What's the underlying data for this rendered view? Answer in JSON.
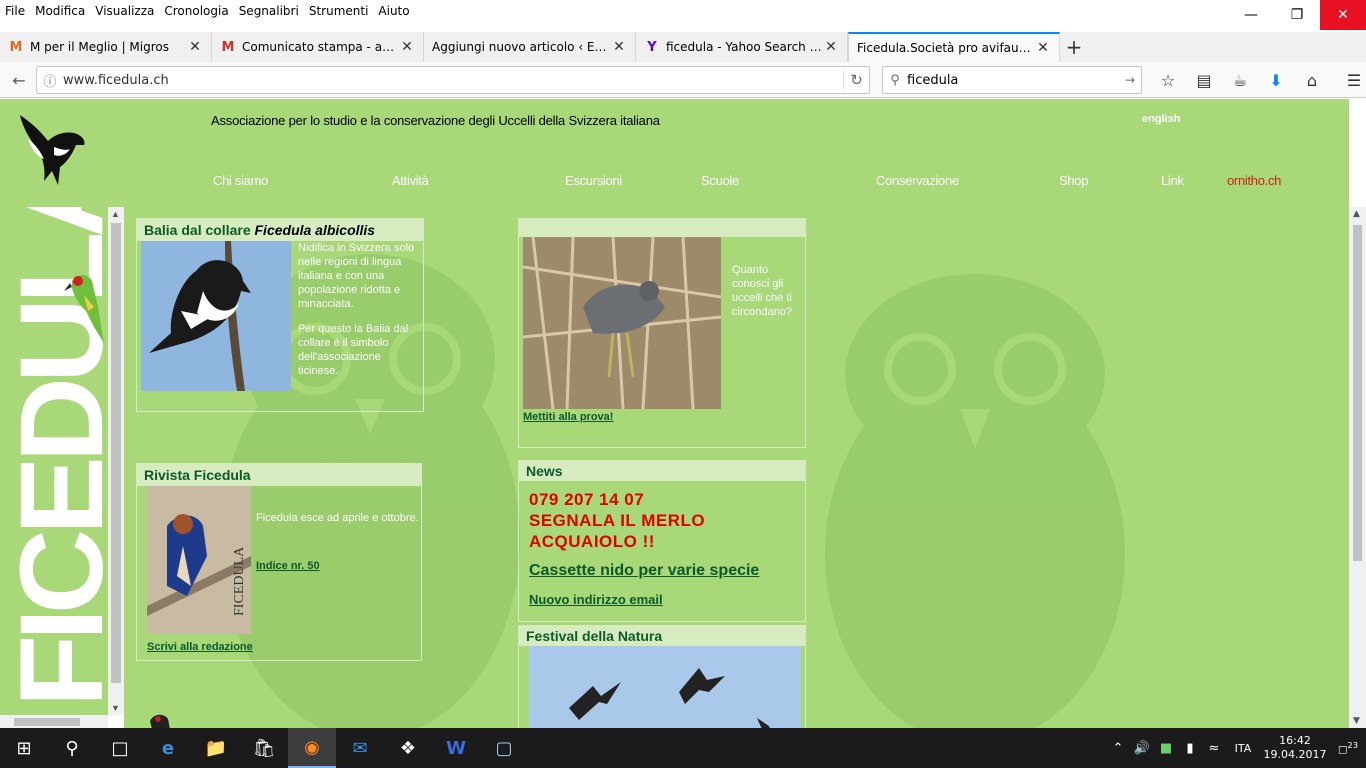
{
  "menubar": [
    "File",
    "Modifica",
    "Visualizza",
    "Cronologia",
    "Segnalibri",
    "Strumenti",
    "Aiuto"
  ],
  "tabs": [
    {
      "favicon": "M",
      "favicon_color": "#e8681c",
      "title": "M per il Meglio | Migros"
    },
    {
      "favicon": "M",
      "favicon_color": "#d93025",
      "title": "Comunicato stampa - ass..."
    },
    {
      "favicon": "",
      "favicon_color": "#666",
      "title": "Aggiungi nuovo articolo ‹ ETi..."
    },
    {
      "favicon": "Y",
      "favicon_color": "#5f01d1",
      "title": "ficedula - Yahoo Search R..."
    },
    {
      "favicon": "",
      "favicon_color": "#666",
      "title": "Ficedula.Società pro avifauna ..."
    }
  ],
  "url": "www.ficedula.ch",
  "search": "ficedula",
  "site": {
    "tagline": "Associazione per lo studio e la conservazione degli Uccelli della Svizzera italiana",
    "lang": "english",
    "nav": [
      "Chi siamo",
      "Attività",
      "Escursioni",
      "Scuole",
      "Conservazione",
      "Shop",
      "Link",
      "ornitho.ch"
    ],
    "left_brand": "FICEDULA",
    "balia": {
      "title": "Balia dal collare",
      "latin": "Ficedula albicollis",
      "text1": "Nidifica in Svizzera solo nelle regioni di lingua italiana e con una popolazione ridotta e minacciata.",
      "text2": "Per questo la Balia dal collare è il simbolo dell'associazione ticinese."
    },
    "rivista": {
      "title": "Rivista Ficedula",
      "cover_text": "FICEDULA",
      "text": "Ficedula esce ad aprile e ottobre.",
      "link1": "Indice nr. 50",
      "link2": "Scrivi alla redazione"
    },
    "quiz": {
      "text": "Quanto conosci gli uccelli che ti circondano?",
      "link": "Mettiti alla prova!"
    },
    "news": {
      "title": "News",
      "red": [
        "079 207 14 07",
        "SEGNALA  IL MERLO",
        "ACQUAIOLO !!"
      ],
      "link1": "Cassette nido per varie specie",
      "link2": "Nuovo indirizzo email"
    },
    "festival": {
      "title": "Festival della Natura"
    }
  },
  "taskbar": {
    "lang": "ITA",
    "time": "16:42",
    "date": "19.04.2017",
    "notifications": "23"
  }
}
